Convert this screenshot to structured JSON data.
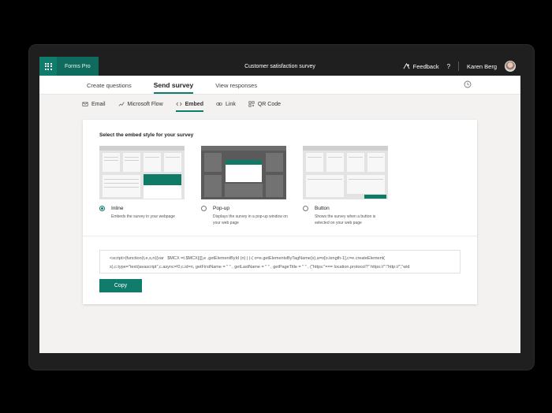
{
  "topbar": {
    "app_name": "Forms Pro",
    "survey_title": "Customer satisfaction survey",
    "feedback_label": "Feedback",
    "help_label": "?",
    "user_name": "Karen Berg"
  },
  "main_tabs": [
    {
      "label": "Create questions"
    },
    {
      "label": "Send survey"
    },
    {
      "label": "View responses"
    }
  ],
  "sub_tabs": [
    {
      "label": "Email",
      "icon": "mail-icon"
    },
    {
      "label": "Microsoft Flow",
      "icon": "flow-icon"
    },
    {
      "label": "Embed",
      "icon": "code-icon"
    },
    {
      "label": "Link",
      "icon": "link-icon"
    },
    {
      "label": "QR Code",
      "icon": "qr-icon"
    }
  ],
  "embed": {
    "title": "Select the embed style for your survey",
    "options": [
      {
        "label": "Inline",
        "description": "Embeds the survey in your webpage",
        "selected": true
      },
      {
        "label": "Pop-up",
        "description": "Displays the survey in a pop-up window on your web page",
        "selected": false
      },
      {
        "label": "Button",
        "description": "Shows the survey when a button is selected on your web page",
        "selected": false
      }
    ],
    "code": "<script>(function(t,e,s,n){var   $MCX =t.$MCX||[],e .getElementById (n) | |-( o=e.getElementsByTagName(s),a=o[o.length-1],c=e.createElement( s),c.type=\"text/javascript\",c.async=!0,c.id=n, getFirstName = \" \" , getLastName = \" \" , getPageTitle = \" \" , (\"https:\"=== location.protocol?\" https://\":\"http://\",\"wid",
    "copy_label": "Copy"
  },
  "colors": {
    "accent": "#107c6c",
    "topbar": "#1f1f1f"
  }
}
